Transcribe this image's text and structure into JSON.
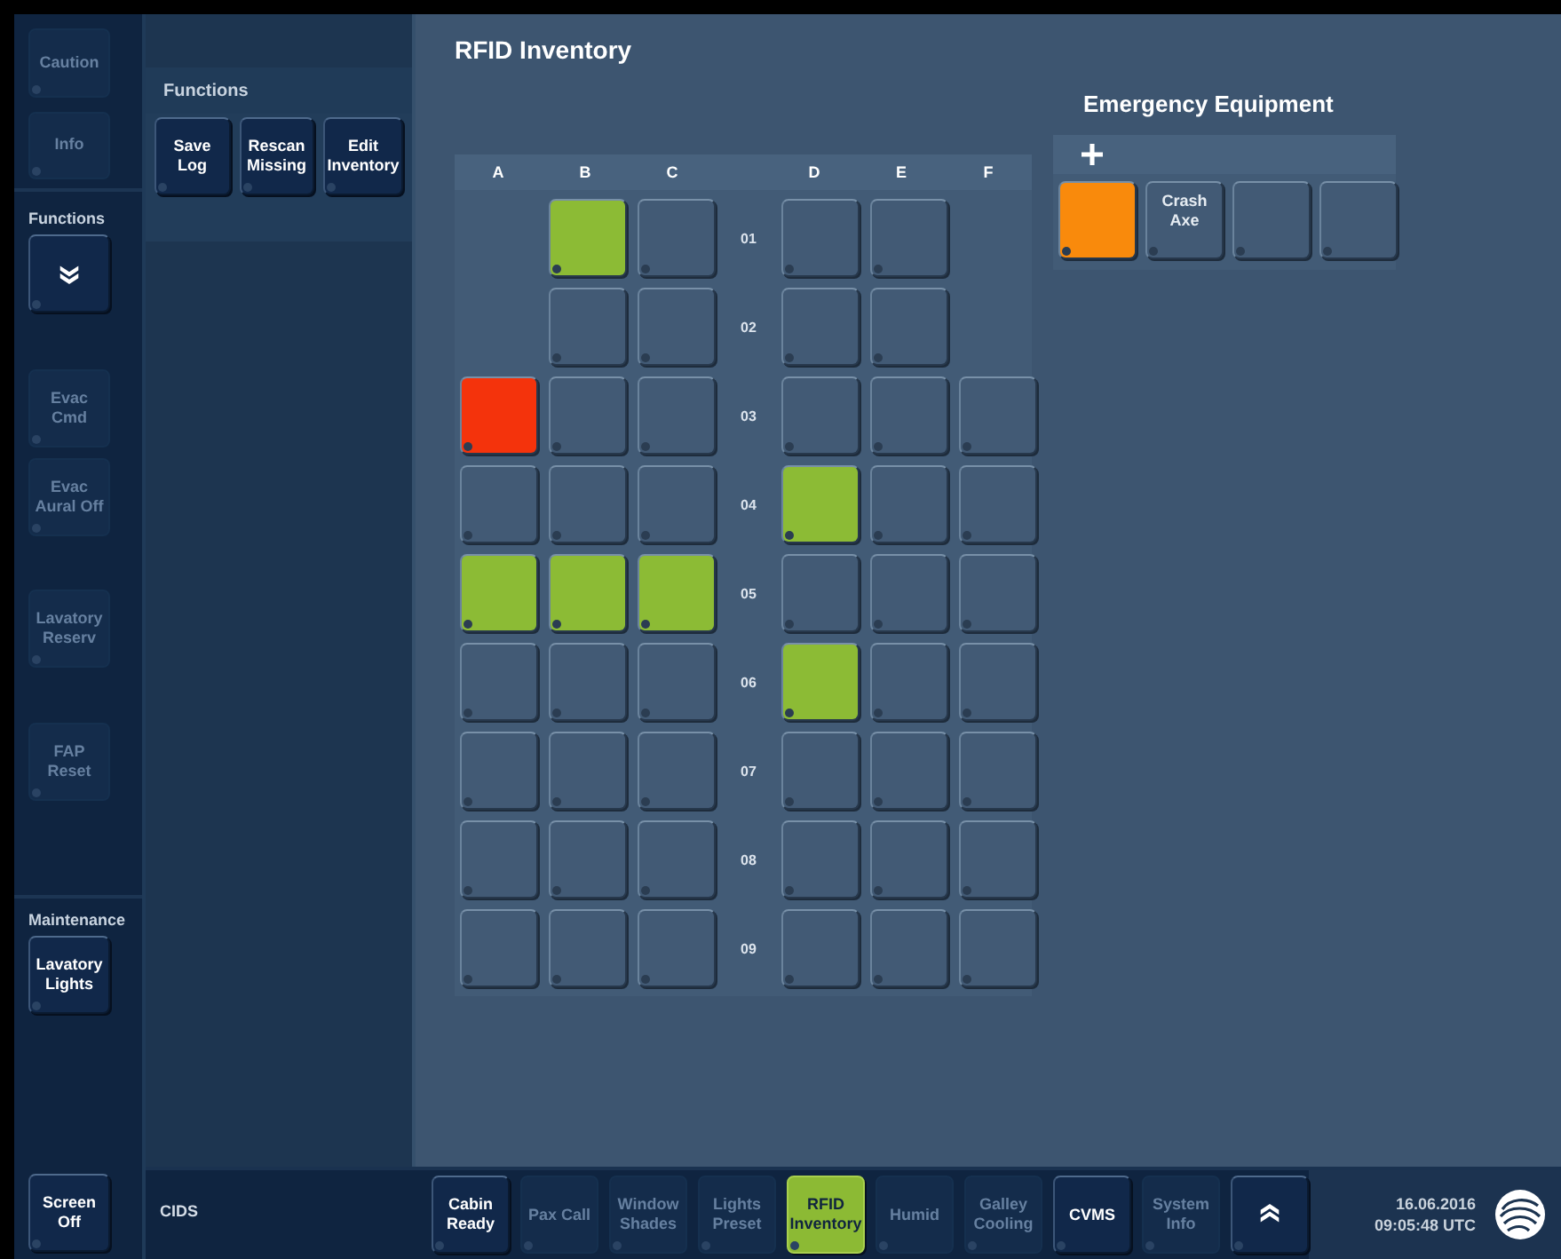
{
  "sidebar": {
    "top_buttons": [
      {
        "label": "Caution",
        "disabled": true
      },
      {
        "label": "Info",
        "disabled": true
      }
    ],
    "sections": [
      {
        "title": "Functions",
        "buttons": [
          {
            "kind": "expand",
            "disabled": false
          },
          {
            "kind": "text",
            "label": "Evac Cmd",
            "disabled": true
          },
          {
            "kind": "text",
            "label": "Evac Aural Off",
            "disabled": true
          },
          {
            "kind": "text",
            "label": "Lavatory Reserv",
            "disabled": true
          },
          {
            "kind": "text",
            "label": "FAP Reset",
            "disabled": true
          }
        ]
      },
      {
        "title": "Maintenance",
        "buttons": [
          {
            "kind": "text",
            "label": "Lavatory Lights",
            "disabled": false
          }
        ]
      }
    ],
    "bottom_button": {
      "label": "Screen Off",
      "disabled": false
    }
  },
  "functions_panel": {
    "title": "Functions",
    "buttons": [
      {
        "label": "Save Log"
      },
      {
        "label": "Rescan Missing"
      },
      {
        "label": "Edit Inventory"
      }
    ]
  },
  "main": {
    "title": "RFID Inventory",
    "grid": {
      "columns": [
        "A",
        "B",
        "C",
        "D",
        "E",
        "F"
      ],
      "rows": [
        {
          "label": "01",
          "cells": [
            {
              "kind": "gap"
            },
            {
              "kind": "slot",
              "color": "#8cbb35"
            },
            {
              "kind": "slot",
              "color": "#425a75"
            },
            {
              "kind": "slot",
              "color": "#425a75"
            },
            {
              "kind": "slot",
              "color": "#425a75"
            },
            {
              "kind": "gap"
            }
          ]
        },
        {
          "label": "02",
          "cells": [
            {
              "kind": "gap"
            },
            {
              "kind": "slot",
              "color": "#425a75"
            },
            {
              "kind": "slot",
              "color": "#425a75"
            },
            {
              "kind": "slot",
              "color": "#425a75"
            },
            {
              "kind": "slot",
              "color": "#425a75"
            },
            {
              "kind": "gap"
            }
          ]
        },
        {
          "label": "03",
          "cells": [
            {
              "kind": "slot",
              "color": "#f4330c"
            },
            {
              "kind": "slot",
              "color": "#425a75"
            },
            {
              "kind": "slot",
              "color": "#425a75"
            },
            {
              "kind": "slot",
              "color": "#425a75"
            },
            {
              "kind": "slot",
              "color": "#425a75"
            },
            {
              "kind": "slot",
              "color": "#425a75"
            }
          ]
        },
        {
          "label": "04",
          "cells": [
            {
              "kind": "slot",
              "color": "#425a75"
            },
            {
              "kind": "slot",
              "color": "#425a75"
            },
            {
              "kind": "slot",
              "color": "#425a75"
            },
            {
              "kind": "slot",
              "color": "#8cbb35"
            },
            {
              "kind": "slot",
              "color": "#425a75"
            },
            {
              "kind": "slot",
              "color": "#425a75"
            }
          ]
        },
        {
          "label": "05",
          "cells": [
            {
              "kind": "slot",
              "color": "#8cbb35"
            },
            {
              "kind": "slot",
              "color": "#8cbb35"
            },
            {
              "kind": "slot",
              "color": "#8cbb35"
            },
            {
              "kind": "slot",
              "color": "#425a75"
            },
            {
              "kind": "slot",
              "color": "#425a75"
            },
            {
              "kind": "slot",
              "color": "#425a75"
            }
          ]
        },
        {
          "label": "06",
          "cells": [
            {
              "kind": "slot",
              "color": "#425a75"
            },
            {
              "kind": "slot",
              "color": "#425a75"
            },
            {
              "kind": "slot",
              "color": "#425a75"
            },
            {
              "kind": "slot",
              "color": "#8cbb35"
            },
            {
              "kind": "slot",
              "color": "#425a75"
            },
            {
              "kind": "slot",
              "color": "#425a75"
            }
          ]
        },
        {
          "label": "07",
          "cells": [
            {
              "kind": "slot",
              "color": "#425a75"
            },
            {
              "kind": "slot",
              "color": "#425a75"
            },
            {
              "kind": "slot",
              "color": "#425a75"
            },
            {
              "kind": "slot",
              "color": "#425a75"
            },
            {
              "kind": "slot",
              "color": "#425a75"
            },
            {
              "kind": "slot",
              "color": "#425a75"
            }
          ]
        },
        {
          "label": "08",
          "cells": [
            {
              "kind": "slot",
              "color": "#425a75"
            },
            {
              "kind": "slot",
              "color": "#425a75"
            },
            {
              "kind": "slot",
              "color": "#425a75"
            },
            {
              "kind": "slot",
              "color": "#425a75"
            },
            {
              "kind": "slot",
              "color": "#425a75"
            },
            {
              "kind": "slot",
              "color": "#425a75"
            }
          ]
        },
        {
          "label": "09",
          "cells": [
            {
              "kind": "slot",
              "color": "#425a75"
            },
            {
              "kind": "slot",
              "color": "#425a75"
            },
            {
              "kind": "slot",
              "color": "#425a75"
            },
            {
              "kind": "slot",
              "color": "#425a75"
            },
            {
              "kind": "slot",
              "color": "#425a75"
            },
            {
              "kind": "slot",
              "color": "#425a75"
            }
          ]
        }
      ]
    },
    "emergency": {
      "title": "Emergency Equipment",
      "items": [
        {
          "kind": "slot",
          "color": "#f98a0c"
        },
        {
          "kind": "slot",
          "color": "#425a75",
          "label": "Crash Axe"
        },
        {
          "kind": "slot",
          "color": "#425a75"
        },
        {
          "kind": "slot",
          "color": "#425a75"
        }
      ]
    }
  },
  "bottom_bar": {
    "title": "CIDS",
    "buttons": [
      {
        "kind": "text",
        "label": "Cabin Ready",
        "disabled": false,
        "selected": false
      },
      {
        "kind": "text",
        "label": "Pax Call",
        "disabled": true,
        "selected": false
      },
      {
        "kind": "text",
        "label": "Window Shades",
        "disabled": true,
        "selected": false
      },
      {
        "kind": "text",
        "label": "Lights Preset",
        "disabled": true,
        "selected": false
      },
      {
        "kind": "text",
        "label": "RFID Inventory",
        "disabled": false,
        "selected": true
      },
      {
        "kind": "text",
        "label": "Humid",
        "disabled": true,
        "selected": false
      },
      {
        "kind": "text",
        "label": "Galley Cooling",
        "disabled": true,
        "selected": false
      },
      {
        "kind": "text",
        "label": "CVMS",
        "disabled": false,
        "selected": false
      },
      {
        "kind": "text",
        "label": "System Info",
        "disabled": true,
        "selected": false
      },
      {
        "kind": "collapse",
        "disabled": false,
        "selected": false
      }
    ],
    "date": "16.06.2016",
    "time": "09:05:48 UTC"
  }
}
